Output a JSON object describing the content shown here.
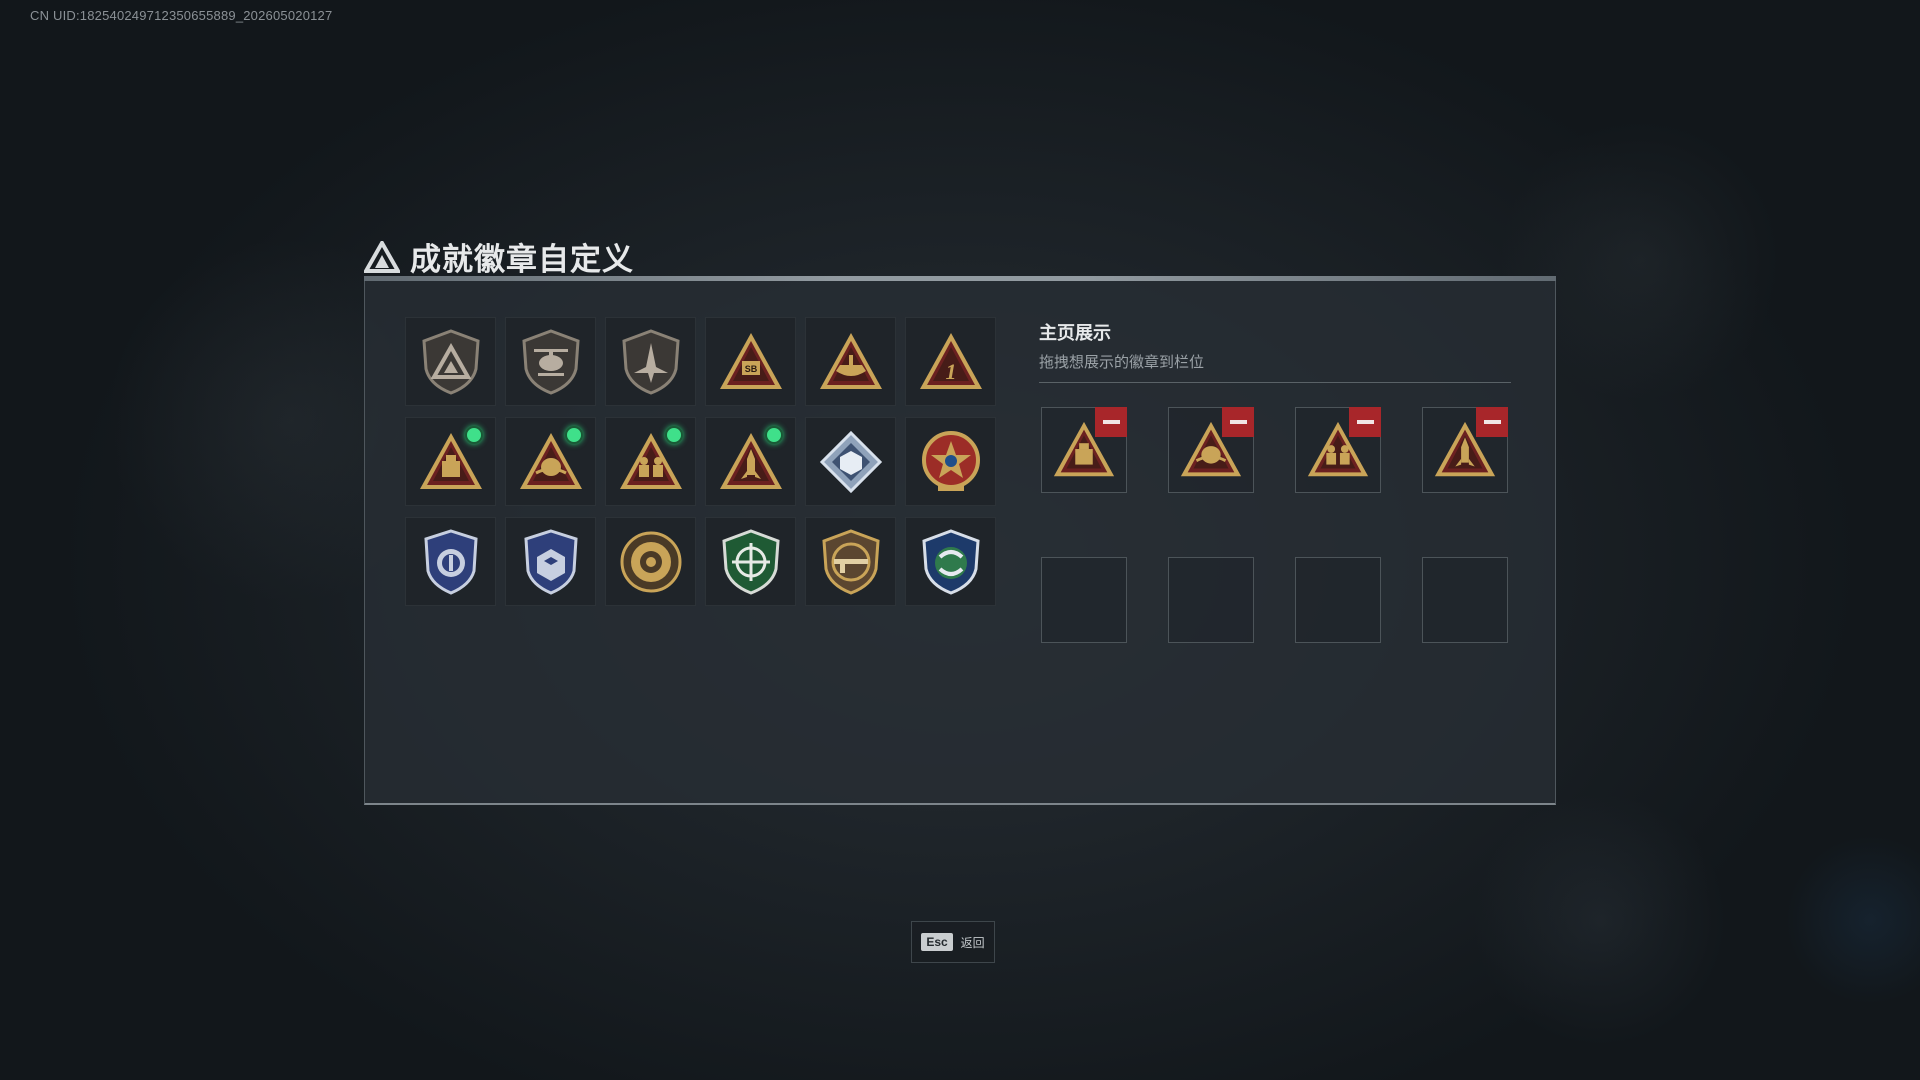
{
  "uid": "CN UID:18254024971235065588​9_202605020127",
  "title": "成就徽章自定义",
  "showcase": {
    "title": "主页展示",
    "subtitle": "拖拽想展示的徽章到栏位"
  },
  "badges": [
    {
      "icon": "gray-triangle-shield-icon",
      "new": false
    },
    {
      "icon": "helicopter-shield-icon",
      "new": false
    },
    {
      "icon": "jet-shield-icon",
      "new": false
    },
    {
      "icon": "sb-triangle-badge-icon",
      "new": false
    },
    {
      "icon": "boat-triangle-badge-icon",
      "new": false
    },
    {
      "icon": "number-one-triangle-badge-icon",
      "new": false
    },
    {
      "icon": "crate-triangle-badge-icon",
      "new": true
    },
    {
      "icon": "lotus-triangle-badge-icon",
      "new": true
    },
    {
      "icon": "soldiers-triangle-badge-icon",
      "new": true
    },
    {
      "icon": "rocket-triangle-badge-icon",
      "new": true
    },
    {
      "icon": "silver-diamond-badge-icon",
      "new": false
    },
    {
      "icon": "star-wreath-medal-icon",
      "new": false
    },
    {
      "icon": "blue-police-shield-icon",
      "new": false
    },
    {
      "icon": "blue-dice-shield-icon",
      "new": false
    },
    {
      "icon": "bronze-round-emblem-icon",
      "new": false
    },
    {
      "icon": "green-crosshair-shield-icon",
      "new": false
    },
    {
      "icon": "rifle-shield-icon",
      "new": false
    },
    {
      "icon": "blue-green-arrows-shield-icon",
      "new": false
    }
  ],
  "slots": [
    {
      "icon": "crate-triangle-badge-icon",
      "filled": true
    },
    {
      "icon": "lotus-triangle-badge-icon",
      "filled": true
    },
    {
      "icon": "soldiers-triangle-badge-icon",
      "filled": true
    },
    {
      "icon": "rocket-triangle-badge-icon",
      "filled": true
    },
    {
      "icon": "",
      "filled": false
    },
    {
      "icon": "",
      "filled": false
    },
    {
      "icon": "",
      "filled": false
    },
    {
      "icon": "",
      "filled": false
    }
  ],
  "esc": {
    "key": "Esc",
    "label": "返回"
  },
  "colors": {
    "accent_green": "#3fe08a",
    "remove_red": "#a8262a",
    "gold": "#c9a458"
  }
}
